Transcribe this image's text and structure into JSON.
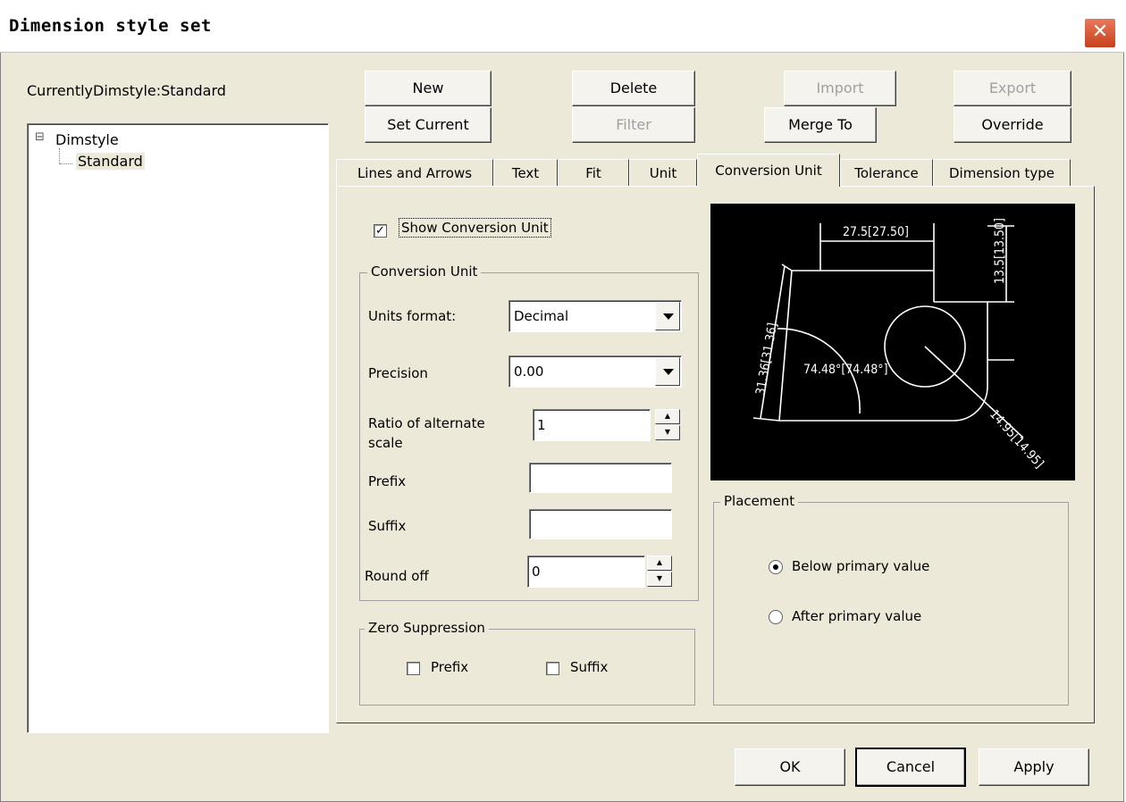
{
  "window": {
    "title": "Dimension style set",
    "close_glyph": "✕"
  },
  "current_style_label": "CurrentlyDimstyle:Standard",
  "toolbar": {
    "new_label": "New",
    "delete_label": "Delete",
    "import_label": "Import",
    "export_label": "Export",
    "set_current_label": "Set Current",
    "filter_label": "Filter",
    "merge_to_label": "Merge To",
    "override_label": "Override"
  },
  "tree": {
    "root_label": "Dimstyle",
    "expand_glyph": "⊟",
    "child_label": "Standard"
  },
  "tabs": [
    {
      "label": "Lines and Arrows"
    },
    {
      "label": "Text"
    },
    {
      "label": "Fit"
    },
    {
      "label": "Unit"
    },
    {
      "label": "Conversion Unit"
    },
    {
      "label": "Tolerance"
    },
    {
      "label": "Dimension type"
    }
  ],
  "show_conversion": {
    "label": "Show Conversion Unit",
    "checked": true,
    "check_glyph": "✓"
  },
  "conversion_unit": {
    "group_label": "Conversion Unit",
    "units_format_label": "Units format:",
    "units_format_value": "Decimal",
    "precision_label": "Precision",
    "precision_value": "0.00",
    "ratio_label_line1": "Ratio of alternate",
    "ratio_label_line2": "scale",
    "ratio_value": "1",
    "prefix_label": "Prefix",
    "prefix_value": "",
    "suffix_label": "Suffix",
    "suffix_value": "",
    "round_off_label": "Round off",
    "round_off_value": "0"
  },
  "zero_suppression": {
    "group_label": "Zero Suppression",
    "prefix_label": "Prefix",
    "suffix_label": "Suffix"
  },
  "preview": {
    "dim_top": "27.5[27.50]",
    "dim_right": "13.5[13.50]",
    "dim_left": "31.36[31.36]",
    "dim_angle": "74.48°[74.48°]",
    "dim_radius": "14.95[14.95]"
  },
  "placement": {
    "group_label": "Placement",
    "below_label": "Below primary value",
    "after_label": "After primary value",
    "selected": "below"
  },
  "footer": {
    "ok_label": "OK",
    "cancel_label": "Cancel",
    "apply_label": "Apply"
  }
}
